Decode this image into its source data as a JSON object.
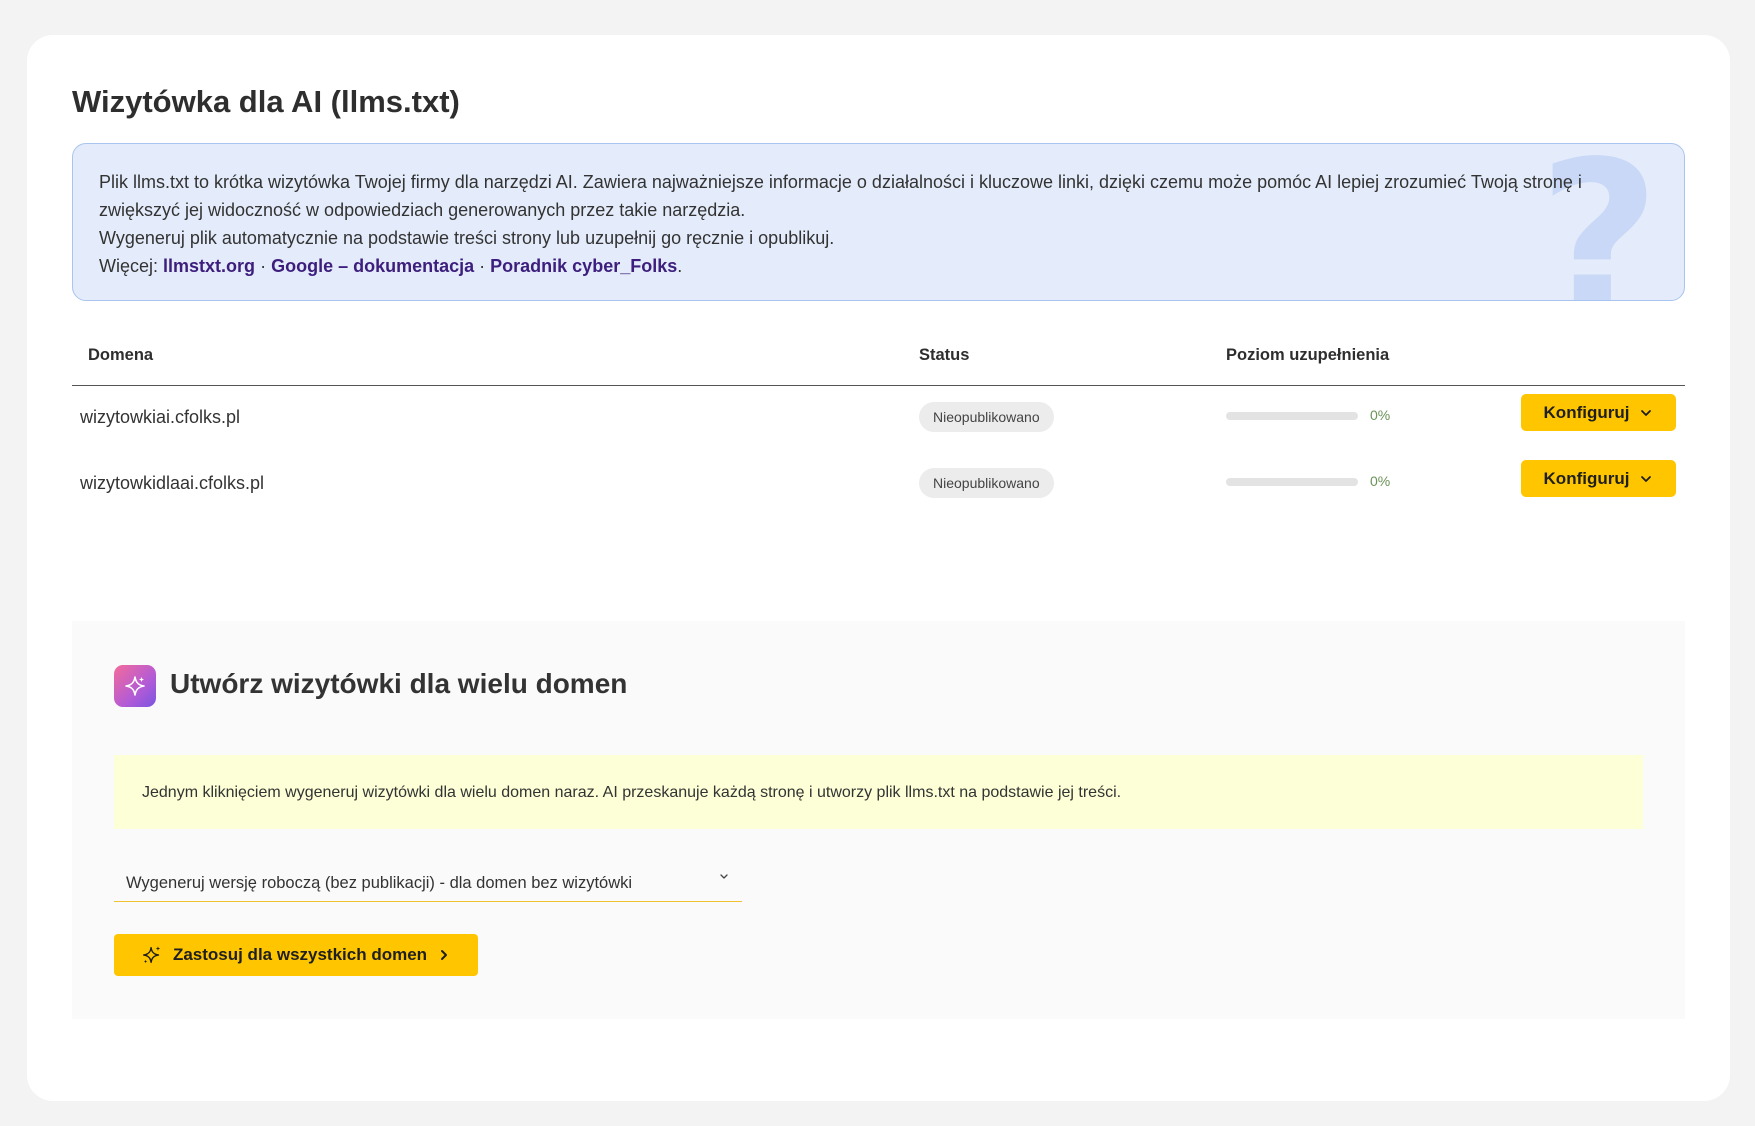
{
  "page": {
    "title": "Wizytówka dla AI (llms.txt)"
  },
  "info": {
    "line1": "Plik llms.txt to krótka wizytówka Twojej firmy dla narzędzi AI. Zawiera najważniejsze informacje o działalności i kluczowe linki, dzięki czemu może pomóc AI lepiej zrozumieć Twoją stronę i zwiększyć jej widoczność w odpowiedziach generowanych przez takie narzędzia.",
    "line2": "Wygeneruj plik automatycznie na podstawie treści strony lub uzupełnij go ręcznie i opublikuj.",
    "more_label": "Więcej:",
    "links": [
      "llmstxt.org",
      "Google – dokumentacja",
      "Poradnik cyber_Folks"
    ],
    "separator": "·",
    "end": ".",
    "decor_glyph": "?"
  },
  "table": {
    "headers": [
      "Domena",
      "Status",
      "Poziom uzupełnienia"
    ],
    "rows": [
      {
        "domain": "wizytowkiai.cfolks.pl",
        "status": "Nieopublikowano",
        "progress": 0,
        "progress_label": "0%",
        "action": "Konfiguruj"
      },
      {
        "domain": "wizytowkidlaai.cfolks.pl",
        "status": "Nieopublikowano",
        "progress": 0,
        "progress_label": "0%",
        "action": "Konfiguruj"
      }
    ]
  },
  "bulk": {
    "title": "Utwórz wizytówki dla wielu domen",
    "note": "Jednym kliknięciem wygeneruj wizytówki dla wielu domen naraz. AI przeskanuje każdą stronę i utworzy plik llms.txt na podstawie jej treści.",
    "select_value": "Wygeneruj wersję roboczą (bez publikacji) - dla domen bez wizytówki",
    "apply_label": "Zastosuj dla wszystkich domen"
  },
  "colors": {
    "accent": "#ffc600",
    "link": "#3d1e7d",
    "info_bg": "#e4ecfb",
    "note_bg": "#fdffd6"
  },
  "icons": [
    "question-mark-decor",
    "chevron-down-icon",
    "sparkle-icon",
    "chevron-right-icon"
  ]
}
